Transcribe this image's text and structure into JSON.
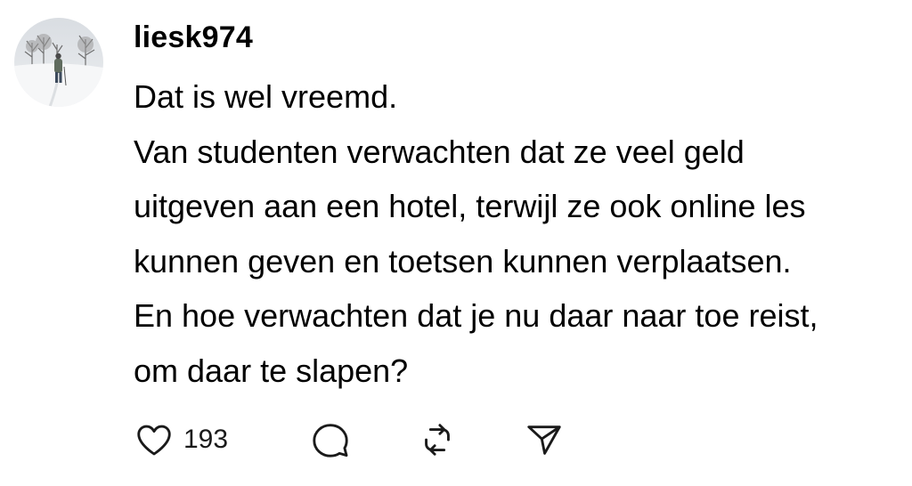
{
  "post": {
    "author": {
      "username": "liesk974",
      "avatar_icon": "avatar-snowy-walk-photo"
    },
    "lines": [
      "Dat is wel vreemd.",
      "Van studenten verwachten dat ze veel geld",
      "uitgeven aan een hotel, terwijl ze ook online les",
      "kunnen geven en toetsen kunnen verplaatsen.",
      "En hoe verwachten dat je nu daar naar toe reist,",
      "om daar te slapen?"
    ],
    "actions": {
      "like_icon": "heart-icon",
      "like_count": "193",
      "reply_icon": "comment-bubble-icon",
      "repost_icon": "repost-icon",
      "share_icon": "send-icon"
    }
  },
  "colors": {
    "text": "#000000",
    "icon_stroke": "#1a1a1a",
    "background": "#ffffff"
  }
}
